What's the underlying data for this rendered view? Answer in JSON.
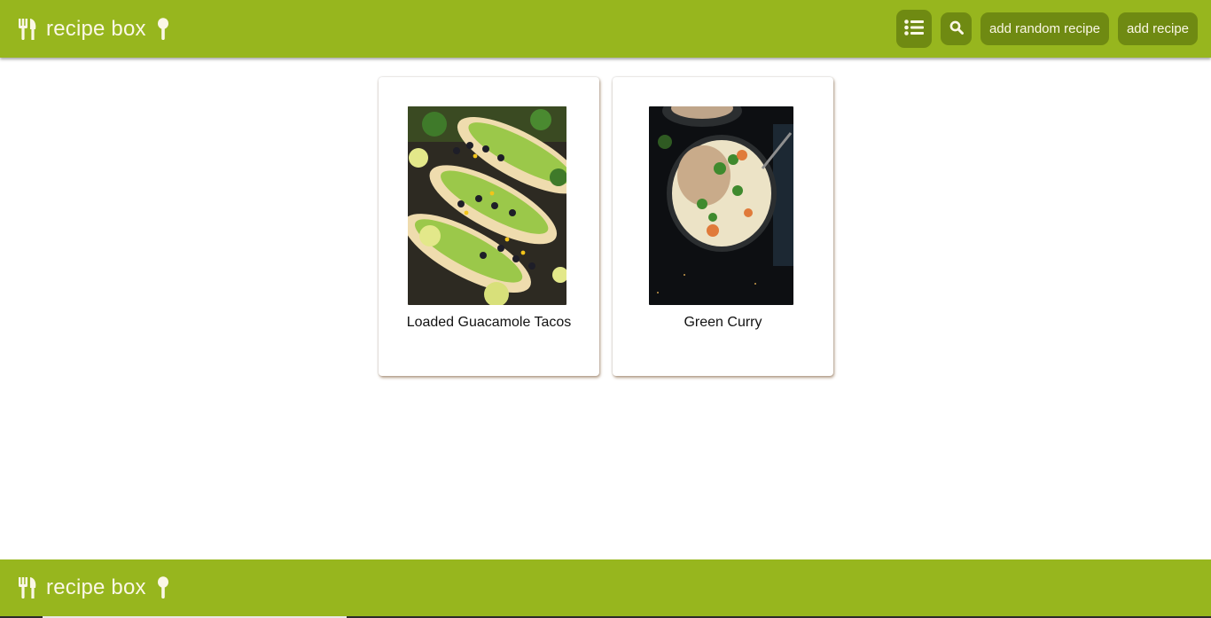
{
  "header": {
    "brand_title": "recipe box",
    "buttons": {
      "add_random_label": "add random recipe",
      "add_label": "add recipe"
    },
    "icons": [
      "utensils-icon",
      "spoon-icon",
      "list-icon",
      "search-icon"
    ]
  },
  "recipes": [
    {
      "name": "Loaded Guacamole Tacos"
    },
    {
      "name": "Green Curry"
    }
  ],
  "footer": {
    "brand_title": "recipe box"
  },
  "colors": {
    "bar": "#97b61e",
    "button": "#6f8a12",
    "text_light": "#fbf7e6"
  }
}
